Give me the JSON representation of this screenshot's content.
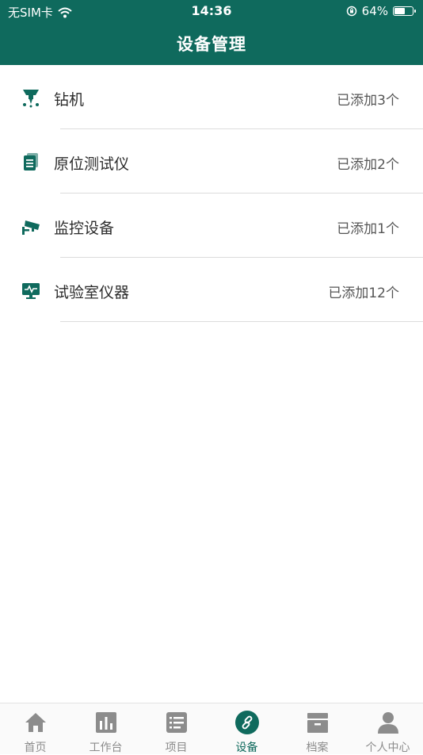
{
  "status_bar": {
    "carrier": "无SIM卡",
    "time": "14:36",
    "battery_percent": "64%",
    "battery_level": 0.64
  },
  "header": {
    "title": "设备管理"
  },
  "devices": [
    {
      "name": "钻机",
      "count": "已添加3个",
      "icon": "drill-icon"
    },
    {
      "name": "原位测试仪",
      "count": "已添加2个",
      "icon": "document-icon"
    },
    {
      "name": "监控设备",
      "count": "已添加1个",
      "icon": "camera-icon"
    },
    {
      "name": "试验室仪器",
      "count": "已添加12个",
      "icon": "monitor-icon"
    }
  ],
  "tabs": [
    {
      "label": "首页",
      "icon": "home-icon"
    },
    {
      "label": "工作台",
      "icon": "chart-icon"
    },
    {
      "label": "项目",
      "icon": "list-icon"
    },
    {
      "label": "设备",
      "icon": "link-icon",
      "active": true
    },
    {
      "label": "档案",
      "icon": "archive-icon"
    },
    {
      "label": "个人中心",
      "icon": "user-icon"
    }
  ],
  "colors": {
    "primary": "#0f6a5d",
    "inactive": "#8c8c8c"
  }
}
